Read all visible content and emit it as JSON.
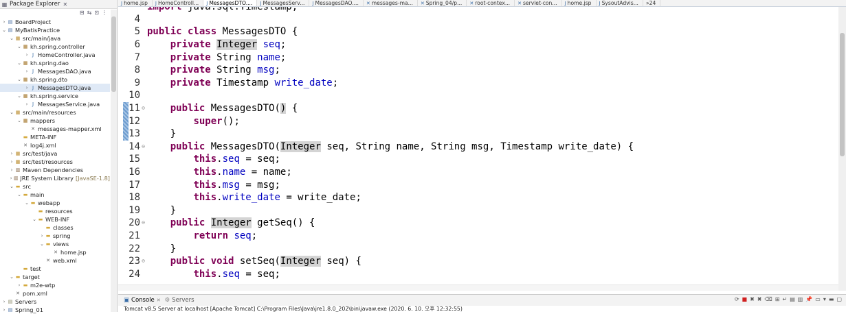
{
  "package_explorer": {
    "title": "Package Explorer",
    "tree": [
      {
        "label": "BoardProject",
        "depth": 0,
        "arrow": "›",
        "icon": "project"
      },
      {
        "label": "MyBatisPractice",
        "depth": 0,
        "arrow": "⌄",
        "icon": "project"
      },
      {
        "label": "src/main/java",
        "depth": 1,
        "arrow": "⌄",
        "icon": "srcfolder"
      },
      {
        "label": "kh.spring.controller",
        "depth": 2,
        "arrow": "⌄",
        "icon": "package"
      },
      {
        "label": "HomeController.java",
        "depth": 3,
        "arrow": "›",
        "icon": "java"
      },
      {
        "label": "kh.spring.dao",
        "depth": 2,
        "arrow": "⌄",
        "icon": "package"
      },
      {
        "label": "MessagesDAO.java",
        "depth": 3,
        "arrow": "›",
        "icon": "java"
      },
      {
        "label": "kh.spring.dto",
        "depth": 2,
        "arrow": "⌄",
        "icon": "package"
      },
      {
        "label": "MessagesDTO.java",
        "depth": 3,
        "arrow": "›",
        "icon": "java",
        "selected": true
      },
      {
        "label": "kh.spring.service",
        "depth": 2,
        "arrow": "⌄",
        "icon": "package"
      },
      {
        "label": "MessagesService.java",
        "depth": 3,
        "arrow": "›",
        "icon": "java"
      },
      {
        "label": "src/main/resources",
        "depth": 1,
        "arrow": "⌄",
        "icon": "srcfolder"
      },
      {
        "label": "mappers",
        "depth": 2,
        "arrow": "⌄",
        "icon": "package"
      },
      {
        "label": "messages-mapper.xml",
        "depth": 3,
        "arrow": "",
        "icon": "xml"
      },
      {
        "label": "META-INF",
        "depth": 2,
        "arrow": "",
        "icon": "folder"
      },
      {
        "label": "log4j.xml",
        "depth": 2,
        "arrow": "",
        "icon": "xml"
      },
      {
        "label": "src/test/java",
        "depth": 1,
        "arrow": "›",
        "icon": "srcfolder"
      },
      {
        "label": "src/test/resources",
        "depth": 1,
        "arrow": "›",
        "icon": "srcfolder"
      },
      {
        "label": "Maven Dependencies",
        "depth": 1,
        "arrow": "›",
        "icon": "lib"
      },
      {
        "label": "JRE System Library",
        "suffix": "[JavaSE-1.8]",
        "depth": 1,
        "arrow": "›",
        "icon": "lib"
      },
      {
        "label": "src",
        "depth": 1,
        "arrow": "⌄",
        "icon": "folder"
      },
      {
        "label": "main",
        "depth": 2,
        "arrow": "⌄",
        "icon": "folder"
      },
      {
        "label": "webapp",
        "depth": 3,
        "arrow": "⌄",
        "icon": "folder"
      },
      {
        "label": "resources",
        "depth": 4,
        "arrow": "",
        "icon": "folder"
      },
      {
        "label": "WEB-INF",
        "depth": 4,
        "arrow": "⌄",
        "icon": "folder"
      },
      {
        "label": "classes",
        "depth": 5,
        "arrow": "",
        "icon": "folder"
      },
      {
        "label": "spring",
        "depth": 5,
        "arrow": "›",
        "icon": "folder"
      },
      {
        "label": "views",
        "depth": 5,
        "arrow": "⌄",
        "icon": "folder"
      },
      {
        "label": "home.jsp",
        "depth": 6,
        "arrow": "",
        "icon": "xml"
      },
      {
        "label": "web.xml",
        "depth": 5,
        "arrow": "",
        "icon": "xml"
      },
      {
        "label": "test",
        "depth": 2,
        "arrow": "",
        "icon": "folder"
      },
      {
        "label": "target",
        "depth": 1,
        "arrow": "⌄",
        "icon": "folder"
      },
      {
        "label": "m2e-wtp",
        "depth": 2,
        "arrow": "›",
        "icon": "folder"
      },
      {
        "label": "pom.xml",
        "depth": 1,
        "arrow": "",
        "icon": "xml"
      },
      {
        "label": "Servers",
        "depth": 0,
        "arrow": "›",
        "icon": "server"
      },
      {
        "label": "Spring_01",
        "depth": 0,
        "arrow": "›",
        "icon": "project"
      }
    ]
  },
  "editor_tabs": [
    {
      "label": "home.jsp",
      "icon": "jsp"
    },
    {
      "label": "HomeControll...",
      "icon": "java"
    },
    {
      "label": "MessagesDTO....",
      "icon": "java",
      "active": true
    },
    {
      "label": "MessagesServ...",
      "icon": "java"
    },
    {
      "label": "MessagesDAO....",
      "icon": "java"
    },
    {
      "label": "messages-ma...",
      "icon": "xml"
    },
    {
      "label": "Spring_04/p...",
      "icon": "xml"
    },
    {
      "label": "root-contex...",
      "icon": "xml"
    },
    {
      "label": "servlet-con...",
      "icon": "xml"
    },
    {
      "label": "home.jsp",
      "icon": "jsp"
    },
    {
      "label": "SysoutAdvis...",
      "icon": "java"
    },
    {
      "label": "»24",
      "icon": ""
    }
  ],
  "editor": {
    "lines": [
      {
        "n": "4",
        "tokens": []
      },
      {
        "n": "5",
        "tokens": [
          [
            "kw",
            "public class "
          ],
          [
            "t",
            "MessagesDTO {"
          ]
        ]
      },
      {
        "n": "6",
        "tokens": [
          [
            "t",
            "    "
          ],
          [
            "kw",
            "private "
          ],
          [
            "hl",
            "Integer"
          ],
          [
            "t",
            " "
          ],
          [
            "fld",
            "seq"
          ],
          [
            "t",
            ";"
          ]
        ]
      },
      {
        "n": "7",
        "tokens": [
          [
            "t",
            "    "
          ],
          [
            "kw",
            "private "
          ],
          [
            "t",
            "String "
          ],
          [
            "fld",
            "name"
          ],
          [
            "t",
            ";"
          ]
        ]
      },
      {
        "n": "8",
        "tokens": [
          [
            "t",
            "    "
          ],
          [
            "kw",
            "private "
          ],
          [
            "t",
            "String "
          ],
          [
            "fld",
            "msg"
          ],
          [
            "t",
            ";"
          ]
        ]
      },
      {
        "n": "9",
        "tokens": [
          [
            "t",
            "    "
          ],
          [
            "kw",
            "private "
          ],
          [
            "t",
            "Timestamp "
          ],
          [
            "fld",
            "write_date"
          ],
          [
            "t",
            ";"
          ]
        ]
      },
      {
        "n": "10",
        "tokens": []
      },
      {
        "n": "11",
        "fold": true,
        "tokens": [
          [
            "t",
            "    "
          ],
          [
            "kw",
            "public "
          ],
          [
            "t",
            "MessagesDTO("
          ],
          [
            "hl",
            ")"
          ],
          [
            "t",
            " {"
          ]
        ]
      },
      {
        "n": "12",
        "tokens": [
          [
            "t",
            "        "
          ],
          [
            "kw",
            "super"
          ],
          [
            "t",
            "();"
          ]
        ]
      },
      {
        "n": "13",
        "tokens": [
          [
            "t",
            "    }"
          ]
        ]
      },
      {
        "n": "14",
        "fold": true,
        "tokens": [
          [
            "t",
            "    "
          ],
          [
            "kw",
            "public "
          ],
          [
            "t",
            "MessagesDTO("
          ],
          [
            "hl",
            "Integer"
          ],
          [
            "t",
            " seq, String name, String msg, Timestamp write_date) {"
          ]
        ]
      },
      {
        "n": "15",
        "tokens": [
          [
            "t",
            "        "
          ],
          [
            "kw",
            "this"
          ],
          [
            "t",
            "."
          ],
          [
            "fld",
            "seq"
          ],
          [
            "t",
            " = seq;"
          ]
        ]
      },
      {
        "n": "16",
        "tokens": [
          [
            "t",
            "        "
          ],
          [
            "kw",
            "this"
          ],
          [
            "t",
            "."
          ],
          [
            "fld",
            "name"
          ],
          [
            "t",
            " = name;"
          ]
        ]
      },
      {
        "n": "17",
        "tokens": [
          [
            "t",
            "        "
          ],
          [
            "kw",
            "this"
          ],
          [
            "t",
            "."
          ],
          [
            "fld",
            "msg"
          ],
          [
            "t",
            " = msg;"
          ]
        ]
      },
      {
        "n": "18",
        "tokens": [
          [
            "t",
            "        "
          ],
          [
            "kw",
            "this"
          ],
          [
            "t",
            "."
          ],
          [
            "fld",
            "write_date"
          ],
          [
            "t",
            " = write_date;"
          ]
        ]
      },
      {
        "n": "19",
        "tokens": [
          [
            "t",
            "    }"
          ]
        ]
      },
      {
        "n": "20",
        "fold": true,
        "tokens": [
          [
            "t",
            "    "
          ],
          [
            "kw",
            "public "
          ],
          [
            "hl",
            "Integer"
          ],
          [
            "t",
            " getSeq() {"
          ]
        ]
      },
      {
        "n": "21",
        "tokens": [
          [
            "t",
            "        "
          ],
          [
            "kw",
            "return "
          ],
          [
            "fld",
            "seq"
          ],
          [
            "t",
            ";"
          ]
        ]
      },
      {
        "n": "22",
        "tokens": [
          [
            "t",
            "    }"
          ]
        ]
      },
      {
        "n": "23",
        "fold": true,
        "tokens": [
          [
            "t",
            "    "
          ],
          [
            "kw",
            "public void "
          ],
          [
            "t",
            "setSeq("
          ],
          [
            "hl",
            "Integer"
          ],
          [
            "t",
            " seq) {"
          ]
        ]
      },
      {
        "n": "24",
        "tokens": [
          [
            "t",
            "        "
          ],
          [
            "kw",
            "this"
          ],
          [
            "t",
            "."
          ],
          [
            "fld",
            "seq"
          ],
          [
            "t",
            " = seq;"
          ]
        ]
      }
    ],
    "partial_top_line": "import java.sql.Timestamp;"
  },
  "console": {
    "tab_console": "Console",
    "tab_servers": "Servers",
    "status_line": "Tomcat v8.5 Server at localhost [Apache Tomcat] C:\\Program Files\\Java\\jre1.8.0_202\\bin\\javaw.exe (2020. 6. 10. 오후 12:32:55)"
  },
  "colors": {
    "keyword": "#7f0055",
    "field": "#0000c0",
    "highlight": "#d4d4d4",
    "selection": "#dfe9f6"
  }
}
